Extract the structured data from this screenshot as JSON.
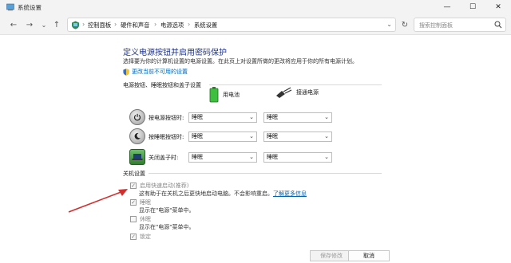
{
  "window": {
    "title": "系统设置"
  },
  "nav": {
    "breadcrumbs": [
      "控制面板",
      "硬件和声音",
      "电源选项",
      "系统设置"
    ],
    "search_placeholder": "搜索控制面板"
  },
  "page": {
    "heading": "定义电源按钮并启用密码保护",
    "description": "选择要为你的计算机设置的电源设置。在此页上对设置所做的更改将应用于你的所有电源计划。",
    "change_link": "更改当前不可用的设置"
  },
  "power_section": {
    "title": "电源按钮、睡眠按钮和盖子设置",
    "battery_label": "用电池",
    "plugged_label": "接通电源",
    "rows": [
      {
        "label": "按电源按钮时:",
        "battery": "睡眠",
        "plugged": "睡眠"
      },
      {
        "label": "按睡眠按钮时:",
        "battery": "睡眠",
        "plugged": "睡眠"
      },
      {
        "label": "关闭盖子时:",
        "battery": "睡眠",
        "plugged": "睡眠"
      }
    ]
  },
  "shutdown_section": {
    "title": "关机设置",
    "items": [
      {
        "label": "启用快速启动(推荐)",
        "desc": "这有助于在关机之后更快地启动电脑。不会影响重启。",
        "link": "了解更多信息",
        "checked": true
      },
      {
        "label": "睡眠",
        "desc": "显示在\"电源\"菜单中。",
        "checked": true
      },
      {
        "label": "休眠",
        "desc": "显示在\"电源\"菜单中。",
        "checked": false
      },
      {
        "label": "锁定",
        "checked": true
      }
    ]
  },
  "buttons": {
    "save": "保存修改",
    "cancel": "取消"
  },
  "colors": {
    "heading": "#1e3287",
    "link": "#0063b1",
    "arrow": "#d32f2f"
  }
}
